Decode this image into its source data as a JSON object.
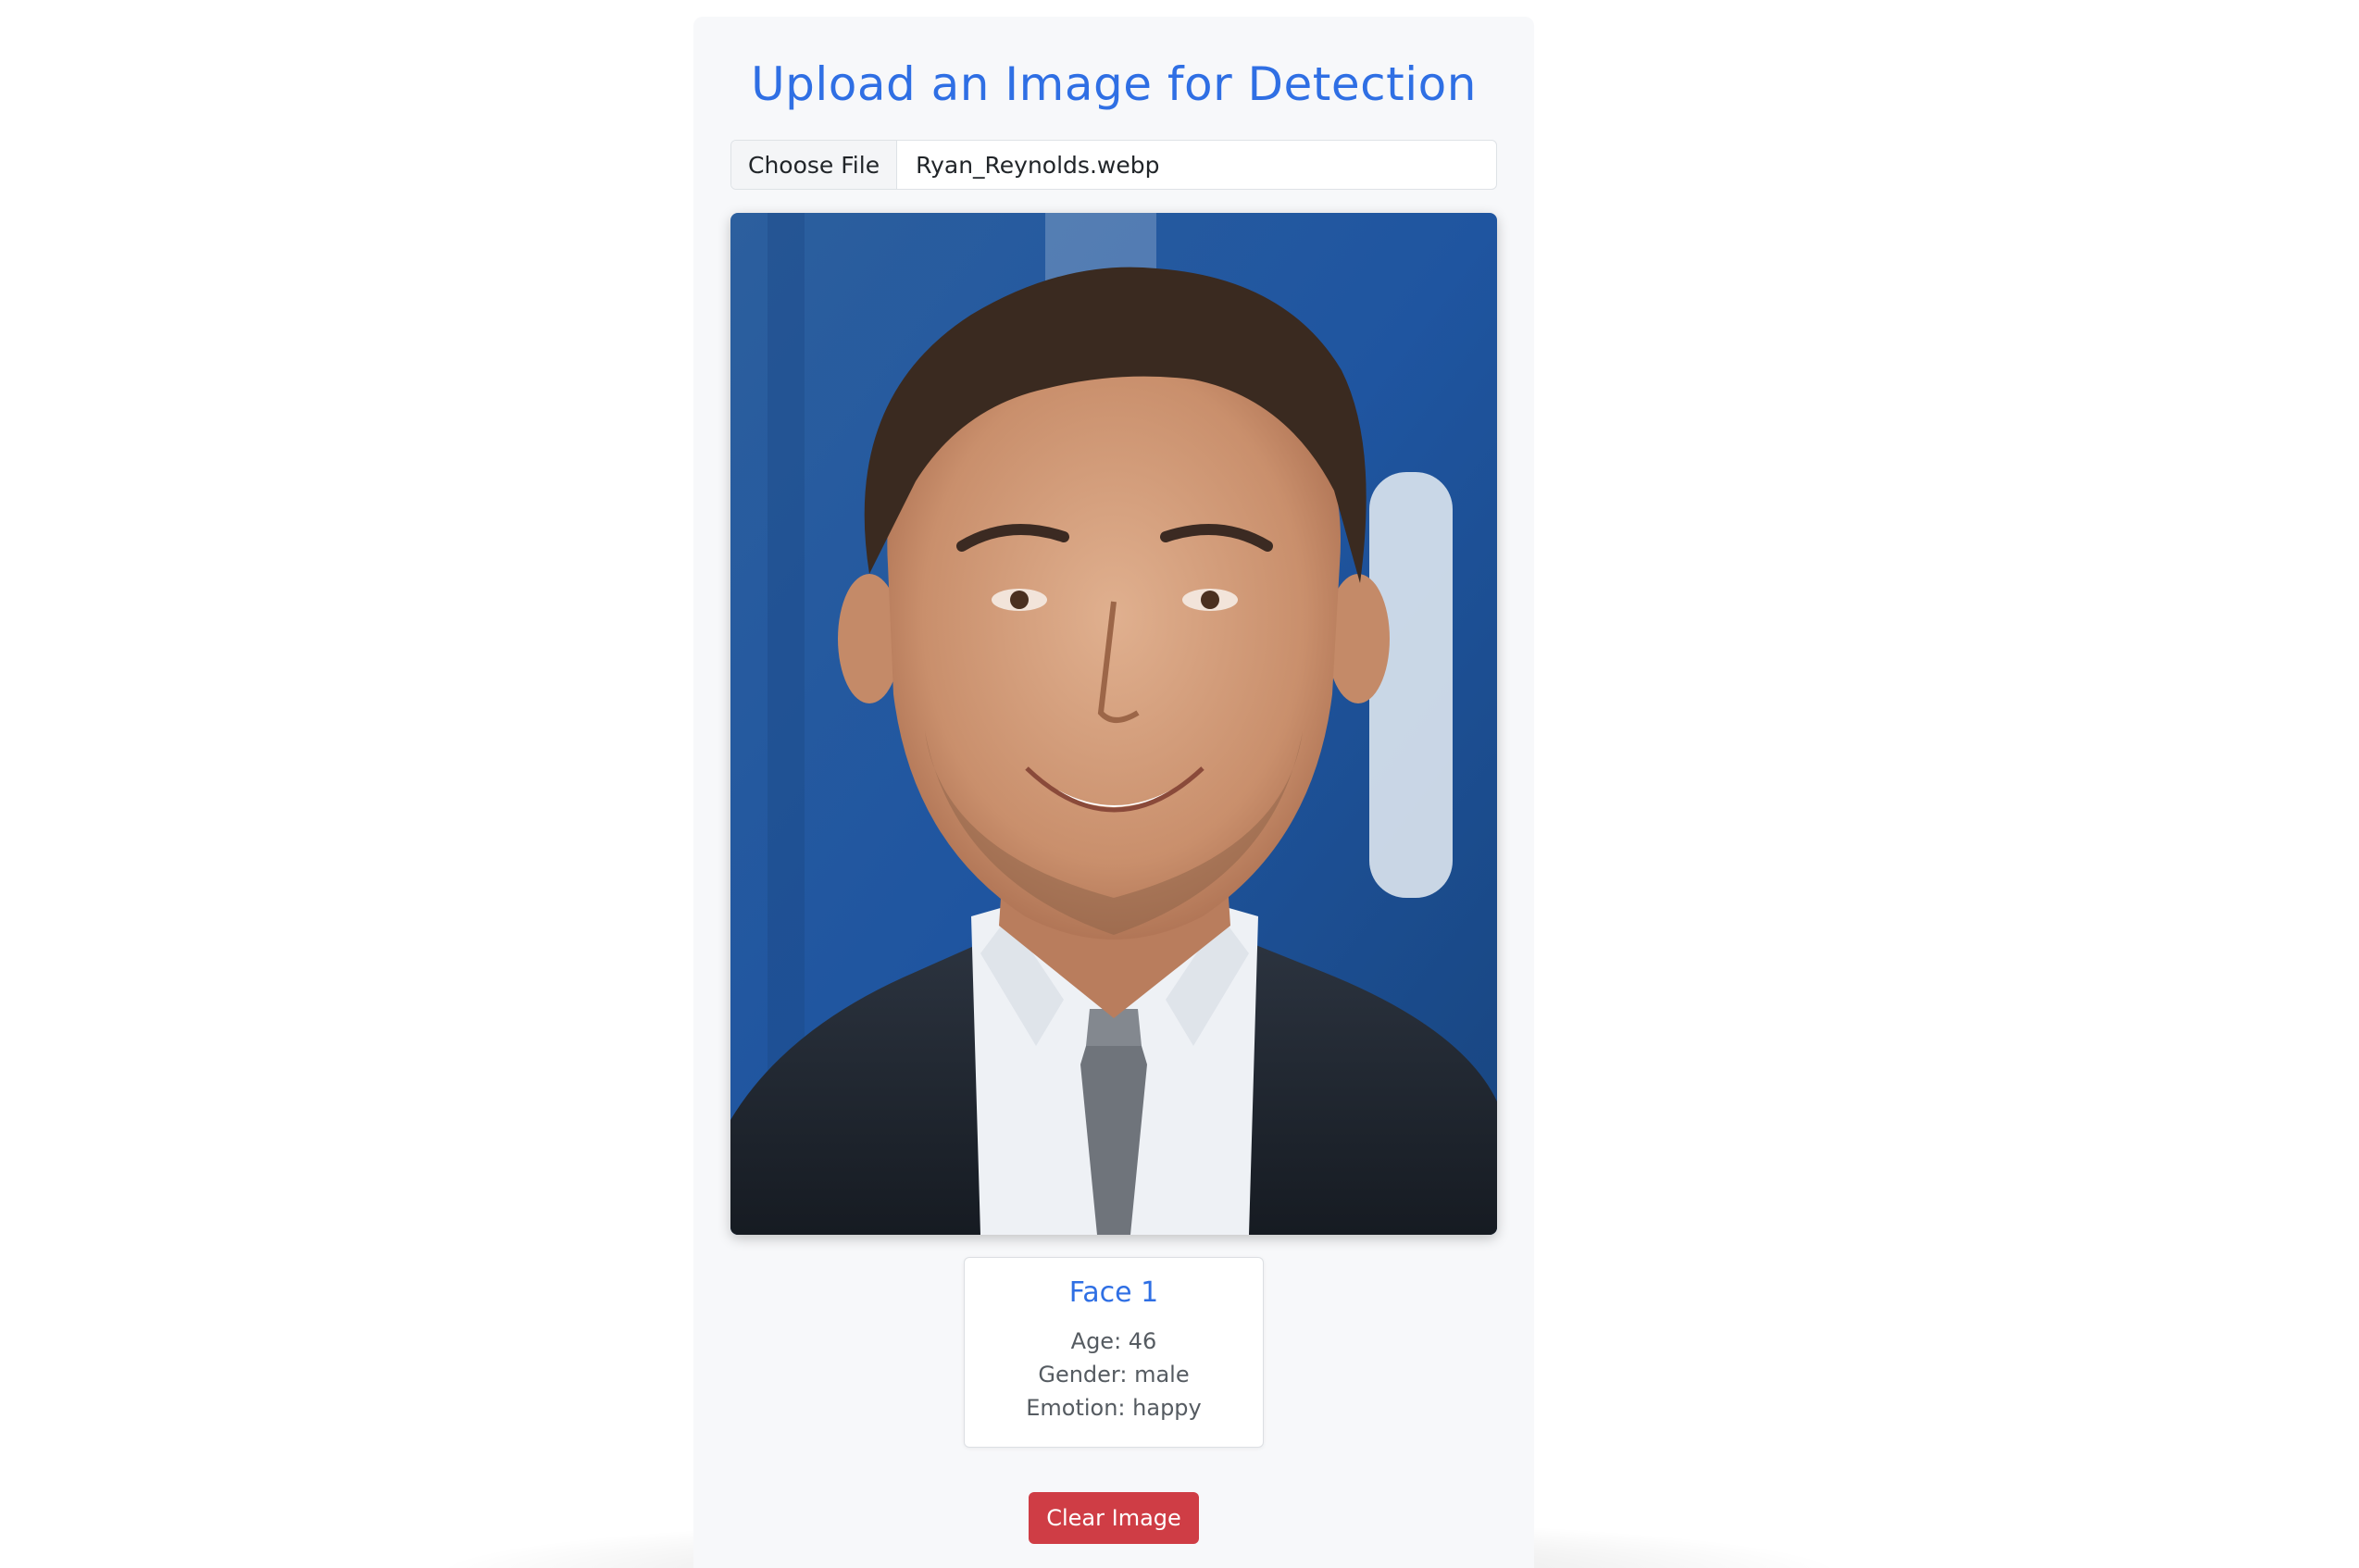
{
  "page": {
    "title": "Upload an Image for Detection"
  },
  "file_input": {
    "button_label": "Choose File",
    "file_name": "Ryan_Reynolds.webp"
  },
  "uploaded_image": {
    "description_icon": "portrait-photo"
  },
  "results": {
    "faces": [
      {
        "title": "Face 1",
        "age": "Age: 46",
        "gender": "Gender: male",
        "emotion": "Emotion: happy"
      }
    ]
  },
  "actions": {
    "clear_label": "Clear Image"
  },
  "colors": {
    "accent": "#2f6fe4",
    "danger": "#cf3d45",
    "panel_bg": "#f7f8fa"
  }
}
